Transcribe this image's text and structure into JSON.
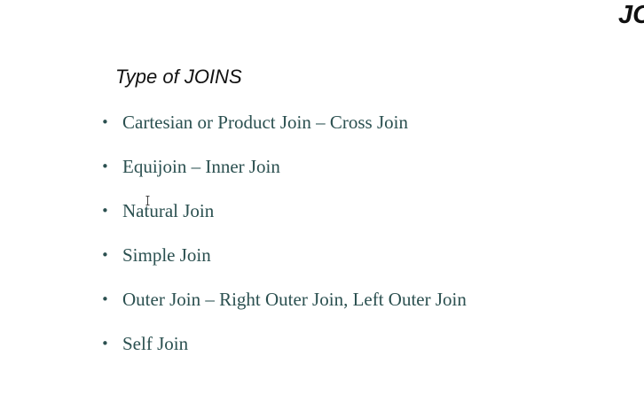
{
  "slide": {
    "corner_title": "JC",
    "subtitle": "Type of JOINS",
    "bullet_glyph": "•",
    "items": [
      "Cartesian or Product Join – Cross Join",
      "Equijoin – Inner Join",
      "Natural Join",
      "Simple Join",
      "Outer Join – Right Outer Join, Left Outer Join",
      "Self Join"
    ]
  },
  "colors": {
    "background": "#ffffff",
    "bullet_text": "#2b5050",
    "heading_text": "#111111"
  },
  "icons": {
    "cursor": "text-cursor-icon"
  }
}
